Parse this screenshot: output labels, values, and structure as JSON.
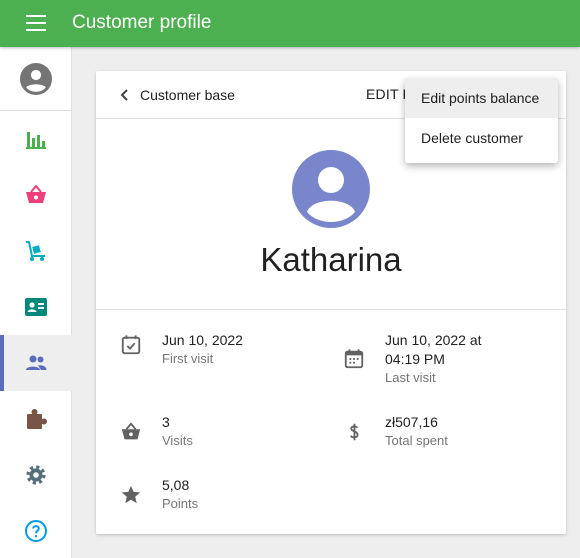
{
  "app": {
    "title": "Customer profile"
  },
  "sidebar": {
    "items": [
      {
        "name": "sales",
        "icon": "bar-chart-icon",
        "color": "#4caf50"
      },
      {
        "name": "shop",
        "icon": "basket-icon",
        "color": "#ec407a"
      },
      {
        "name": "products",
        "icon": "dolly-icon",
        "color": "#00acc1"
      },
      {
        "name": "employees",
        "icon": "id-card-icon",
        "color": "#00897b"
      },
      {
        "name": "customers",
        "icon": "people-icon",
        "color": "#5c6bc0",
        "active": true
      },
      {
        "name": "addons",
        "icon": "puzzle-icon",
        "color": "#795548"
      },
      {
        "name": "settings",
        "icon": "gear-icon",
        "color": "#546e7a"
      },
      {
        "name": "help",
        "icon": "help-icon",
        "color": "#039be5"
      }
    ]
  },
  "card": {
    "back_label": "Customer base",
    "edit_label": "EDIT P",
    "customer_name": "Katharina",
    "info": {
      "first_visit": {
        "value": "Jun 10, 2022",
        "label": "First visit"
      },
      "last_visit": {
        "value_line1": "Jun 10, 2022 at",
        "value_line2": "04:19 PM",
        "label": "Last visit"
      },
      "visits": {
        "value": "3",
        "label": "Visits"
      },
      "total_spent": {
        "value": "zł507,16",
        "label": "Total spent"
      },
      "points": {
        "value": "5,08",
        "label": "Points"
      }
    }
  },
  "menu": {
    "items": [
      {
        "label": "Edit points balance"
      },
      {
        "label": "Delete customer"
      }
    ]
  }
}
